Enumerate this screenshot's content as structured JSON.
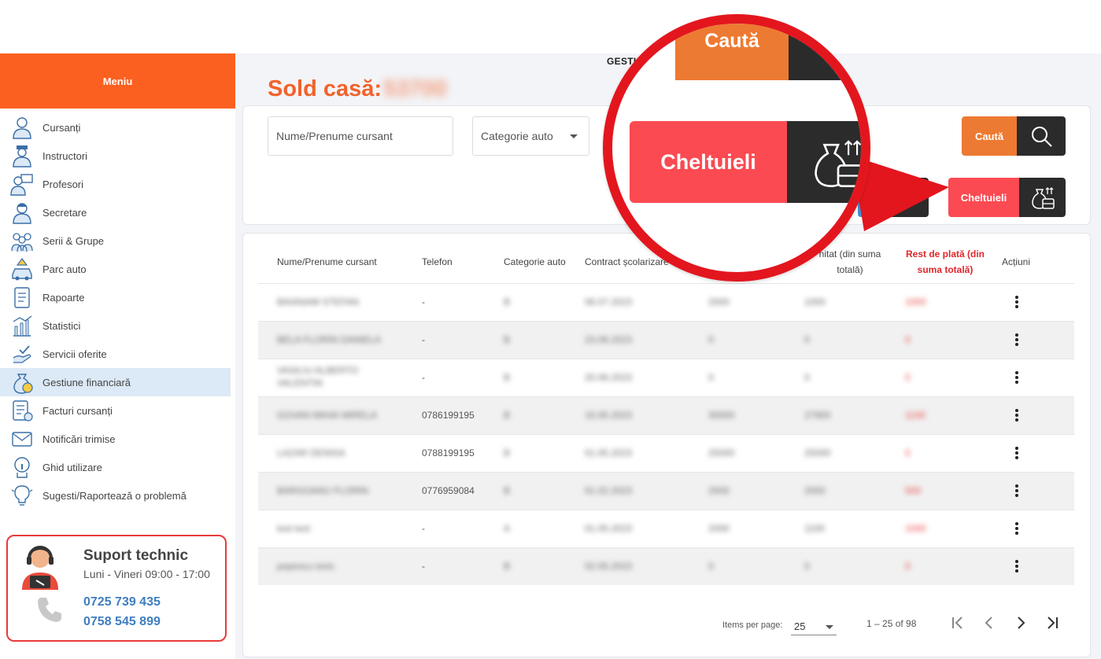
{
  "sidebar": {
    "menu_title": "Meniu",
    "items": [
      {
        "label": "Cursanți",
        "icon": "students-icon",
        "active": false
      },
      {
        "label": "Instructori",
        "icon": "instructor-icon",
        "active": false
      },
      {
        "label": "Profesori",
        "icon": "teacher-icon",
        "active": false
      },
      {
        "label": "Secretare",
        "icon": "secretary-icon",
        "active": false
      },
      {
        "label": "Serii & Grupe",
        "icon": "groups-icon",
        "active": false
      },
      {
        "label": "Parc auto",
        "icon": "car-icon",
        "active": false
      },
      {
        "label": "Rapoarte",
        "icon": "report-icon",
        "active": false
      },
      {
        "label": "Statistici",
        "icon": "statistics-icon",
        "active": false
      },
      {
        "label": "Servicii oferite",
        "icon": "services-icon",
        "active": false
      },
      {
        "label": "Gestiune financiară",
        "icon": "money-bag-icon",
        "active": true
      },
      {
        "label": "Facturi cursanți",
        "icon": "invoice-icon",
        "active": false
      },
      {
        "label": "Notificări trimise",
        "icon": "envelope-icon",
        "active": false
      },
      {
        "label": "Ghid utilizare",
        "icon": "guide-icon",
        "active": false
      },
      {
        "label": "Sugesti/Raportează o problemă",
        "icon": "lightbulb-icon",
        "active": false
      }
    ]
  },
  "support": {
    "title": "Suport technic",
    "hours": "Luni - Vineri 09:00 - 17:00",
    "phone1": "0725 739 435",
    "phone2": "0758 545 899"
  },
  "main": {
    "title": "GESTI",
    "sold_label": "Sold casă:",
    "sold_value": "53700"
  },
  "filters": {
    "name_placeholder": "Nume/Prenume cursant",
    "category_placeholder": "Categorie auto",
    "search_label": "Caută",
    "expenses_label": "Cheltuieli"
  },
  "table": {
    "headers": {
      "name": "Nume/Prenume cursant",
      "phone": "Telefon",
      "category": "Categorie auto",
      "contract": "Contract școlarizare",
      "paid": "nitat (din suma totală)",
      "rest": "Rest de plată (din suma totală)",
      "actions": "Acțiuni"
    },
    "rows": [
      {
        "name": "BAIANAM STEFAN",
        "phone": "-",
        "cat": "B",
        "date": "06.07.2023",
        "total": "2000",
        "paid": "1000",
        "rest": "1000"
      },
      {
        "name": "BELA FLORIN DANIELA",
        "phone": "-",
        "cat": "B",
        "date": "23.06.2023",
        "total": "0",
        "paid": "0",
        "rest": "0"
      },
      {
        "name": "VASILIU ALBERTO VALENTIN",
        "phone": "-",
        "cat": "B",
        "date": "20.06.2023",
        "total": "0",
        "paid": "0",
        "rest": "0"
      },
      {
        "name": "GOVAN MIHAI MIRELA",
        "phone": "0786199195",
        "cat": "B",
        "date": "15.05.2023",
        "total": "30000",
        "paid": "27900",
        "rest": "1100"
      },
      {
        "name": "LAZAR DENISA",
        "phone": "0788199195",
        "cat": "B",
        "date": "01.05.2023",
        "total": "25000",
        "paid": "25000",
        "rest": "0"
      },
      {
        "name": "BARGOANU FLORIN",
        "phone": "0776959084",
        "cat": "B",
        "date": "01.02.2023",
        "total": "2500",
        "paid": "2000",
        "rest": "500"
      },
      {
        "name": "test test",
        "phone": "-",
        "cat": "A",
        "date": "01.05.2023",
        "total": "2000",
        "paid": "1100",
        "rest": "1000"
      },
      {
        "name": "popescu ionic",
        "phone": "-",
        "cat": "B",
        "date": "02.05.2023",
        "total": "0",
        "paid": "0",
        "rest": "0"
      }
    ]
  },
  "pagination": {
    "items_label": "Items per page:",
    "per_page": "25",
    "range": "1 – 25 of 98"
  },
  "colors": {
    "accent_orange": "#fb6020",
    "search_orange": "#ed7a32",
    "expenses_red": "#fb4a52",
    "dark_button": "#2b2b2b",
    "highlight_red": "#e3161e"
  }
}
